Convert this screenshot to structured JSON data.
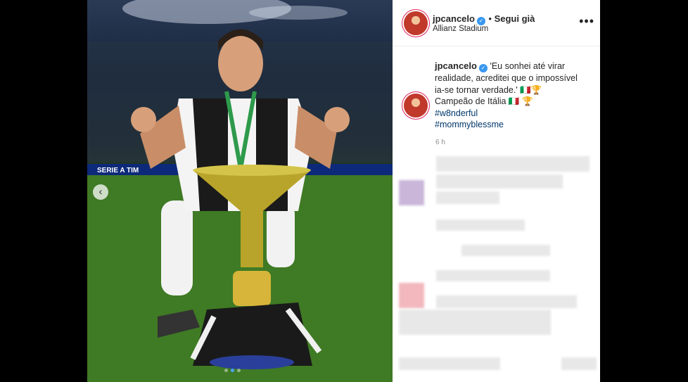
{
  "post": {
    "username": "jpcancelo",
    "follow_status": "Segui già",
    "location": "Allianz Stadium",
    "more_label": "•••",
    "caption": {
      "username": "jpcancelo",
      "text": "'Eu sonhei até virar realidade, acreditei que o impossível ia-se tornar verdade.' 🇮🇹🏆",
      "line2": "Campeão de Itália 🇮🇹 🏆",
      "hashtags": [
        "#w8nderful",
        "#mommyblessme"
      ]
    },
    "timestamp": "6 h",
    "photo": {
      "board_text": "SERIE A TIM",
      "carousel_total": 3,
      "carousel_active": 1
    }
  },
  "colors": {
    "verified": "#3897f0",
    "hashtag": "#00376b",
    "accent_ring": "#e0245e"
  }
}
